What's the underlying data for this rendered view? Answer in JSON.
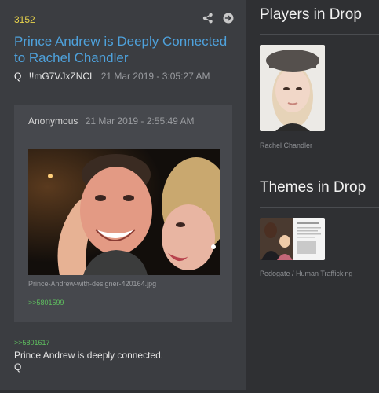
{
  "post": {
    "drop_number": "3152",
    "title": "Prince Andrew is Deeply Connected to Rachel Chandler",
    "author": "Q",
    "tripcode": "!!mG7VJxZNCI",
    "date": "21 Mar 2019 - 3:05:27 AM",
    "quote": {
      "author": "Anonymous",
      "date": "21 Mar 2019 - 2:55:49 AM",
      "image_filename": "Prince-Andrew-with-designer-420164.jpg",
      "post_ref": ">>5801599"
    },
    "reply_ref": ">>5801617",
    "reply_text": "Prince Andrew is deeply connected.",
    "signature": "Q"
  },
  "sidebar": {
    "players_heading": "Players in Drop",
    "player_name": "Rachel Chandler",
    "themes_heading": "Themes in Drop",
    "theme_name": "Pedogate / Human Trafficking"
  },
  "icons": [
    "share-icon",
    "arrow-right-circle-icon"
  ],
  "colors": {
    "accent_link": "#4ea1db",
    "drop_number": "#e8d34c",
    "post_ref": "#5fbf5f",
    "background": "#2f3033",
    "post_bg": "#3b3d41"
  }
}
